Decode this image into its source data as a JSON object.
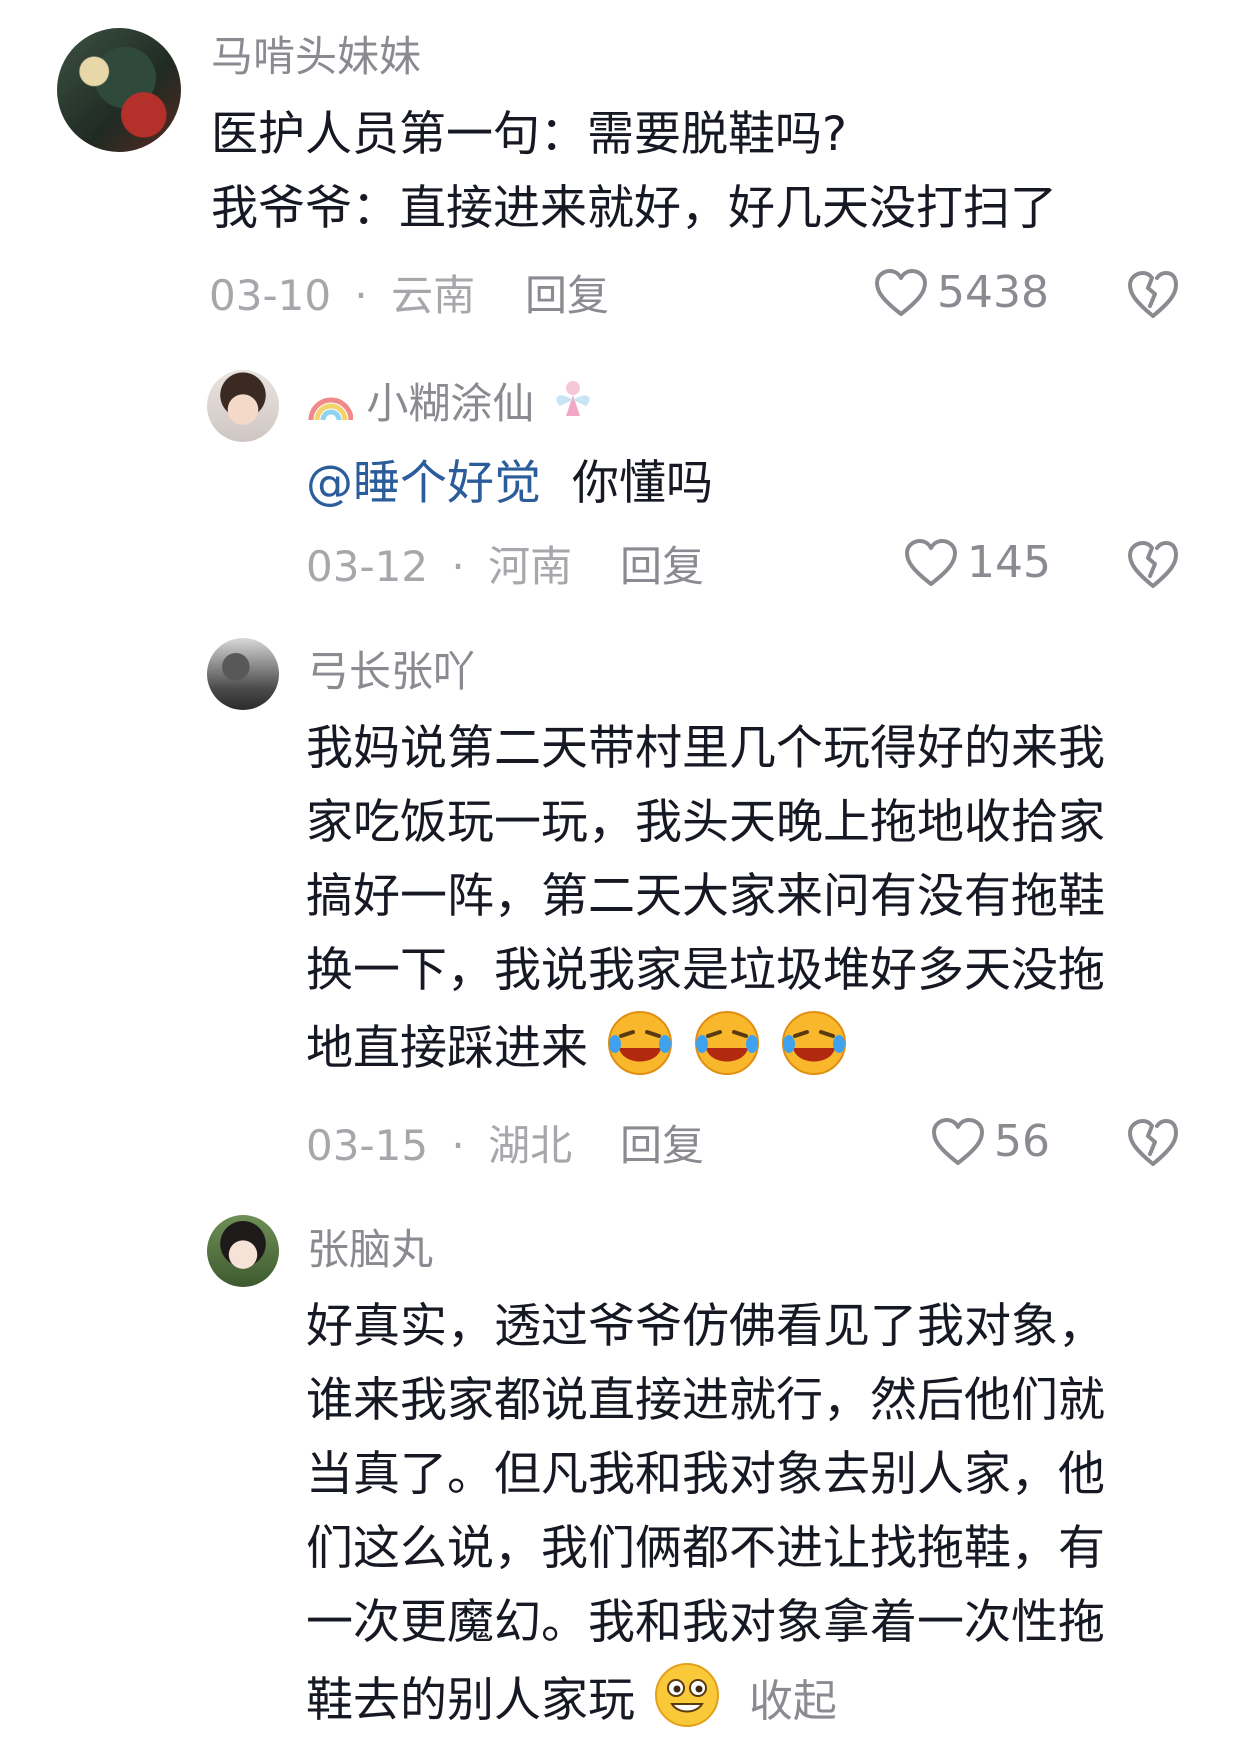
{
  "comments": [
    {
      "username": "马啃头妹妹",
      "lines": [
        "医护人员第一句：需要脱鞋吗?",
        "我爷爷：直接进来就好，好几天没打扫了"
      ],
      "date": "03-10",
      "location": "云南",
      "reply_label": "回复",
      "likes": "5438"
    }
  ],
  "replies": [
    {
      "username": "小糊涂仙",
      "mention": "@睡个好觉",
      "text": "你懂吗",
      "date": "03-12",
      "location": "河南",
      "reply_label": "回复",
      "likes": "145"
    },
    {
      "username": "弓长张吖",
      "lines": [
        "我妈说第二天带村里几个玩得好的来我",
        "家吃饭玩一玩，我头天晚上拖地收拾家",
        "搞好一阵，第二天大家来问有没有拖鞋",
        "换一下，我说我家是垃圾堆好多天没拖",
        "地直接踩进来"
      ],
      "emoji": "rolling-laugh-emoji",
      "date": "03-15",
      "location": "湖北",
      "reply_label": "回复",
      "likes": "56"
    },
    {
      "username": "张脑丸",
      "lines": [
        "好真实，透过爷爷仿佛看见了我对象，",
        "谁来我家都说直接进就行，然后他们就",
        "当真了。但凡我和我对象去别人家，他",
        "们这么说，我们俩都不进让找拖鞋，有",
        "一次更魔幻。我和我对象拿着一次性拖",
        "鞋去的别人家玩"
      ],
      "emoji": "grin-emoji",
      "collapse_label": "收起"
    }
  ],
  "separator": "·",
  "colors": {
    "mention": "#2b5d9b",
    "meta": "#a6a7ab",
    "text": "#161823"
  }
}
